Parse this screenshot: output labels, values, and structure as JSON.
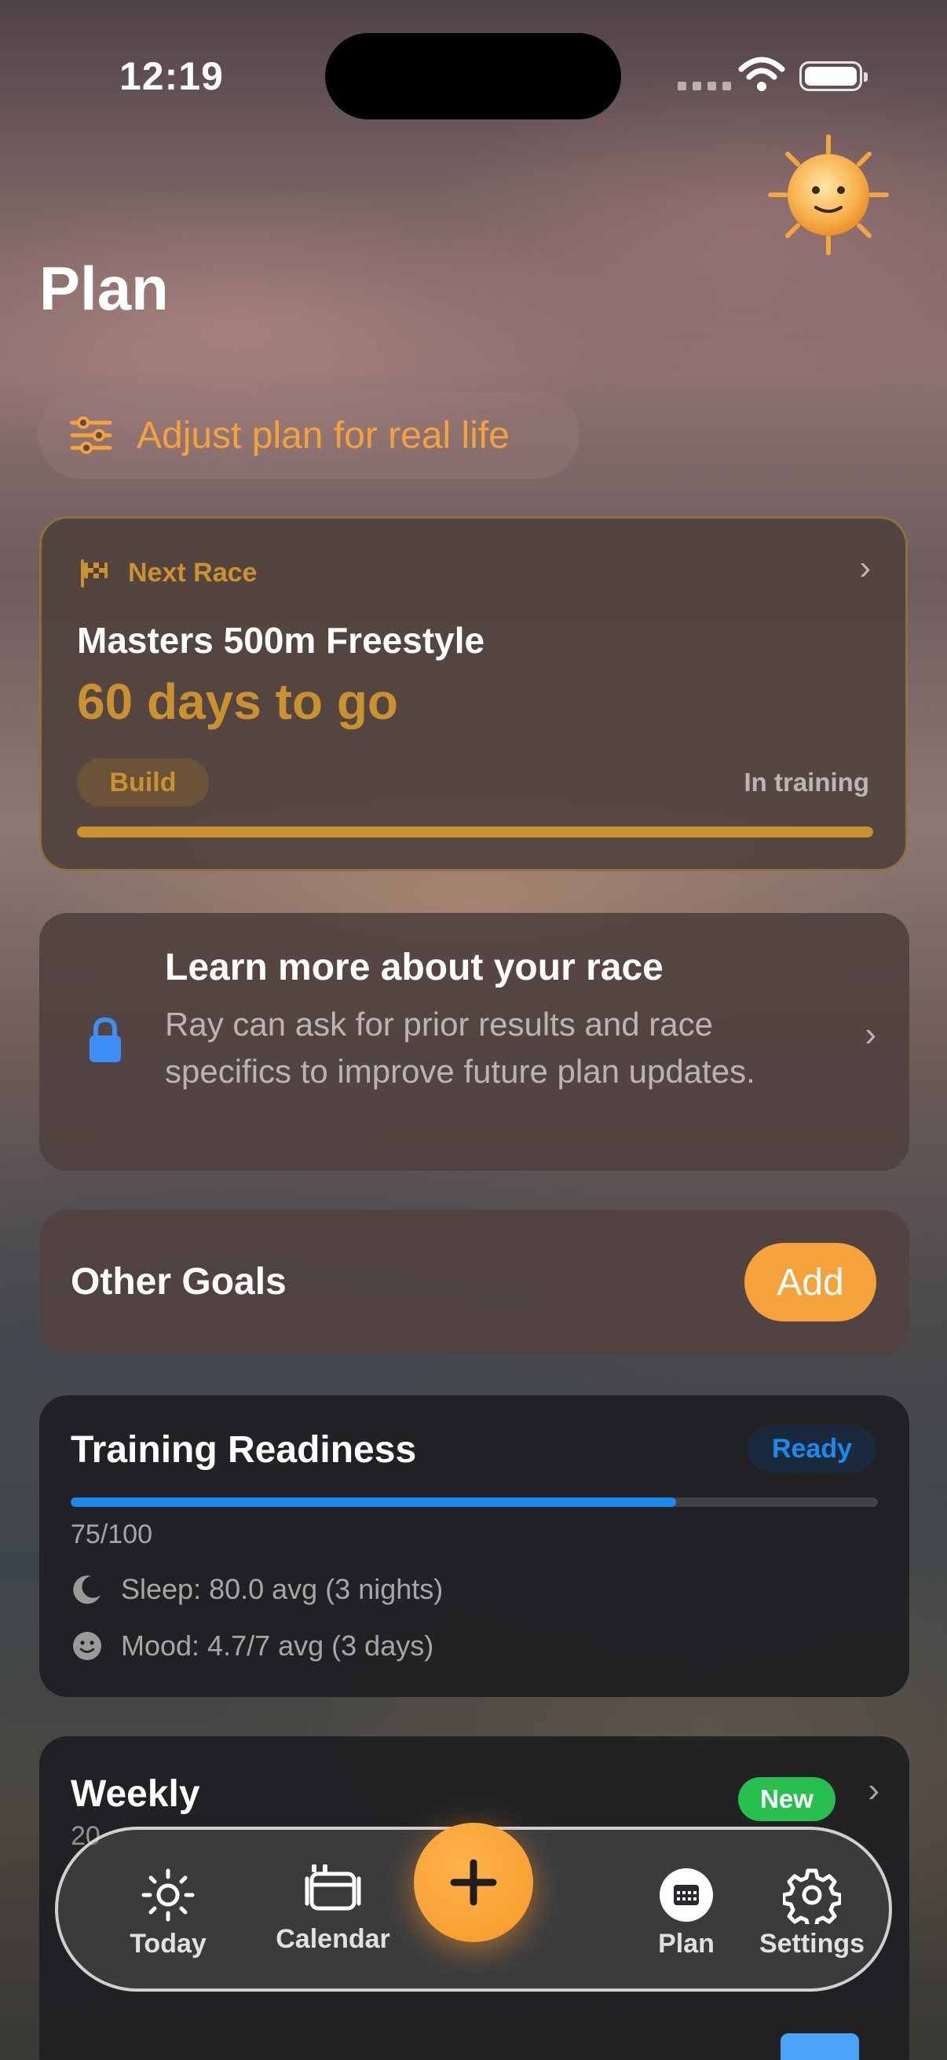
{
  "status_bar": {
    "time": "12:19"
  },
  "header": {
    "title": "Plan",
    "avatar_icon": "sun-face-icon"
  },
  "adjust": {
    "label": "Adjust plan for real life",
    "icon": "sliders-icon"
  },
  "next_race": {
    "header_label": "Next Race",
    "name": "Masters 500m Freestyle",
    "countdown": "60 days to go",
    "phase": "Build",
    "status": "In training",
    "progress": 1.0,
    "accent": "#c9922e"
  },
  "learn_more": {
    "title": "Learn more about your race",
    "description": "Ray can ask for prior results and race specifics to improve future plan updates.",
    "icon": "lock-icon"
  },
  "other_goals": {
    "title": "Other Goals",
    "add_label": "Add",
    "accent": "#f5a23a"
  },
  "readiness": {
    "title": "Training Readiness",
    "badge": "Ready",
    "score_text": "75/100",
    "score": 75,
    "score_max": 100,
    "sleep": "Sleep: 80.0 avg (3 nights)",
    "mood": "Mood: 4.7/7 avg (3 days)",
    "accent": "#1a8af0"
  },
  "weekly": {
    "title": "Weekly",
    "badge": "New",
    "subtitle_partial": "20"
  },
  "tabbar": {
    "today": "Today",
    "calendar": "Calendar",
    "plan": "Plan",
    "settings": "Settings",
    "fab_icon": "plus-icon"
  }
}
